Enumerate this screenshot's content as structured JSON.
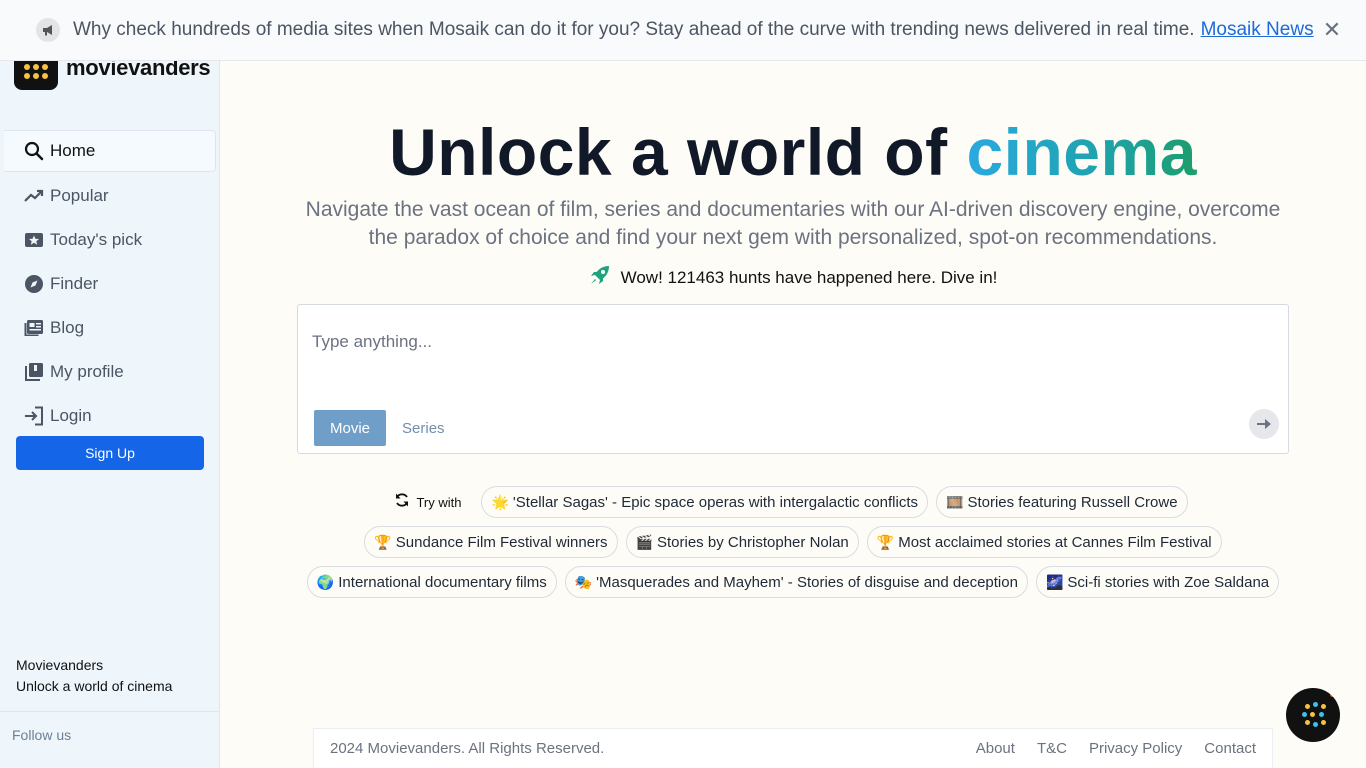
{
  "banner": {
    "text": "Why check hundreds of media sites when Mosaik can do it for you? Stay ahead of the curve with trending news delivered in real time.",
    "link": "Mosaik News",
    "close": "✕"
  },
  "sidebar": {
    "logo_text": "movievanders",
    "items": [
      {
        "label": "Home",
        "icon": "search-icon"
      },
      {
        "label": "Popular",
        "icon": "trending-icon"
      },
      {
        "label": "Today's pick",
        "icon": "star-ticket-icon"
      },
      {
        "label": "Finder",
        "icon": "compass-icon"
      },
      {
        "label": "Blog",
        "icon": "newspaper-icon"
      },
      {
        "label": "My profile",
        "icon": "library-icon"
      },
      {
        "label": "Login",
        "icon": "login-icon"
      }
    ],
    "signup": "Sign Up",
    "brand_name": "Movievanders",
    "brand_tagline": "Unlock a world of cinema",
    "follow": "Follow us"
  },
  "hero": {
    "title_prefix": "Unlock a world of",
    "title_accent": "cinema",
    "subtitle": "Navigate the vast ocean of film, series and documentaries with our AI-driven discovery engine, overcome the paradox of choice and find your next gem with personalized, spot-on recommendations.",
    "hunts": "Wow! 121463 hunts have happened here. Dive in!"
  },
  "search": {
    "placeholder": "Type anything...",
    "value": "",
    "modes": [
      "Movie",
      "Series"
    ],
    "selected": "Movie"
  },
  "suggestions": {
    "try_label": "Try with",
    "chips": [
      {
        "emoji": "🌟",
        "text": "'Stellar Sagas' - Epic space operas with intergalactic conflicts"
      },
      {
        "emoji": "🎞️",
        "text": "Stories featuring Russell Crowe"
      },
      {
        "emoji": "🏆",
        "text": "Sundance Film Festival winners"
      },
      {
        "emoji": "🎬",
        "text": "Stories by Christopher Nolan"
      },
      {
        "emoji": "🏆",
        "text": "Most acclaimed stories at Cannes Film Festival"
      },
      {
        "emoji": "🌍",
        "text": "International documentary films"
      },
      {
        "emoji": "🎭",
        "text": "'Masquerades and Mayhem' - Stories of disguise and deception"
      },
      {
        "emoji": "🌌",
        "text": "Sci-fi stories with Zoe Saldana"
      }
    ]
  },
  "footer": {
    "copyright": "2024 Movievanders. All Rights Reserved.",
    "links": [
      "About",
      "T&C",
      "Privacy Policy",
      "Contact"
    ]
  },
  "colors": {
    "accent": "#1565e8",
    "sidebar_bg": "#eef6fc",
    "page_bg": "#fdfcf7",
    "title_gradient": [
      "#2aa9e0",
      "#1c9e6c"
    ]
  }
}
